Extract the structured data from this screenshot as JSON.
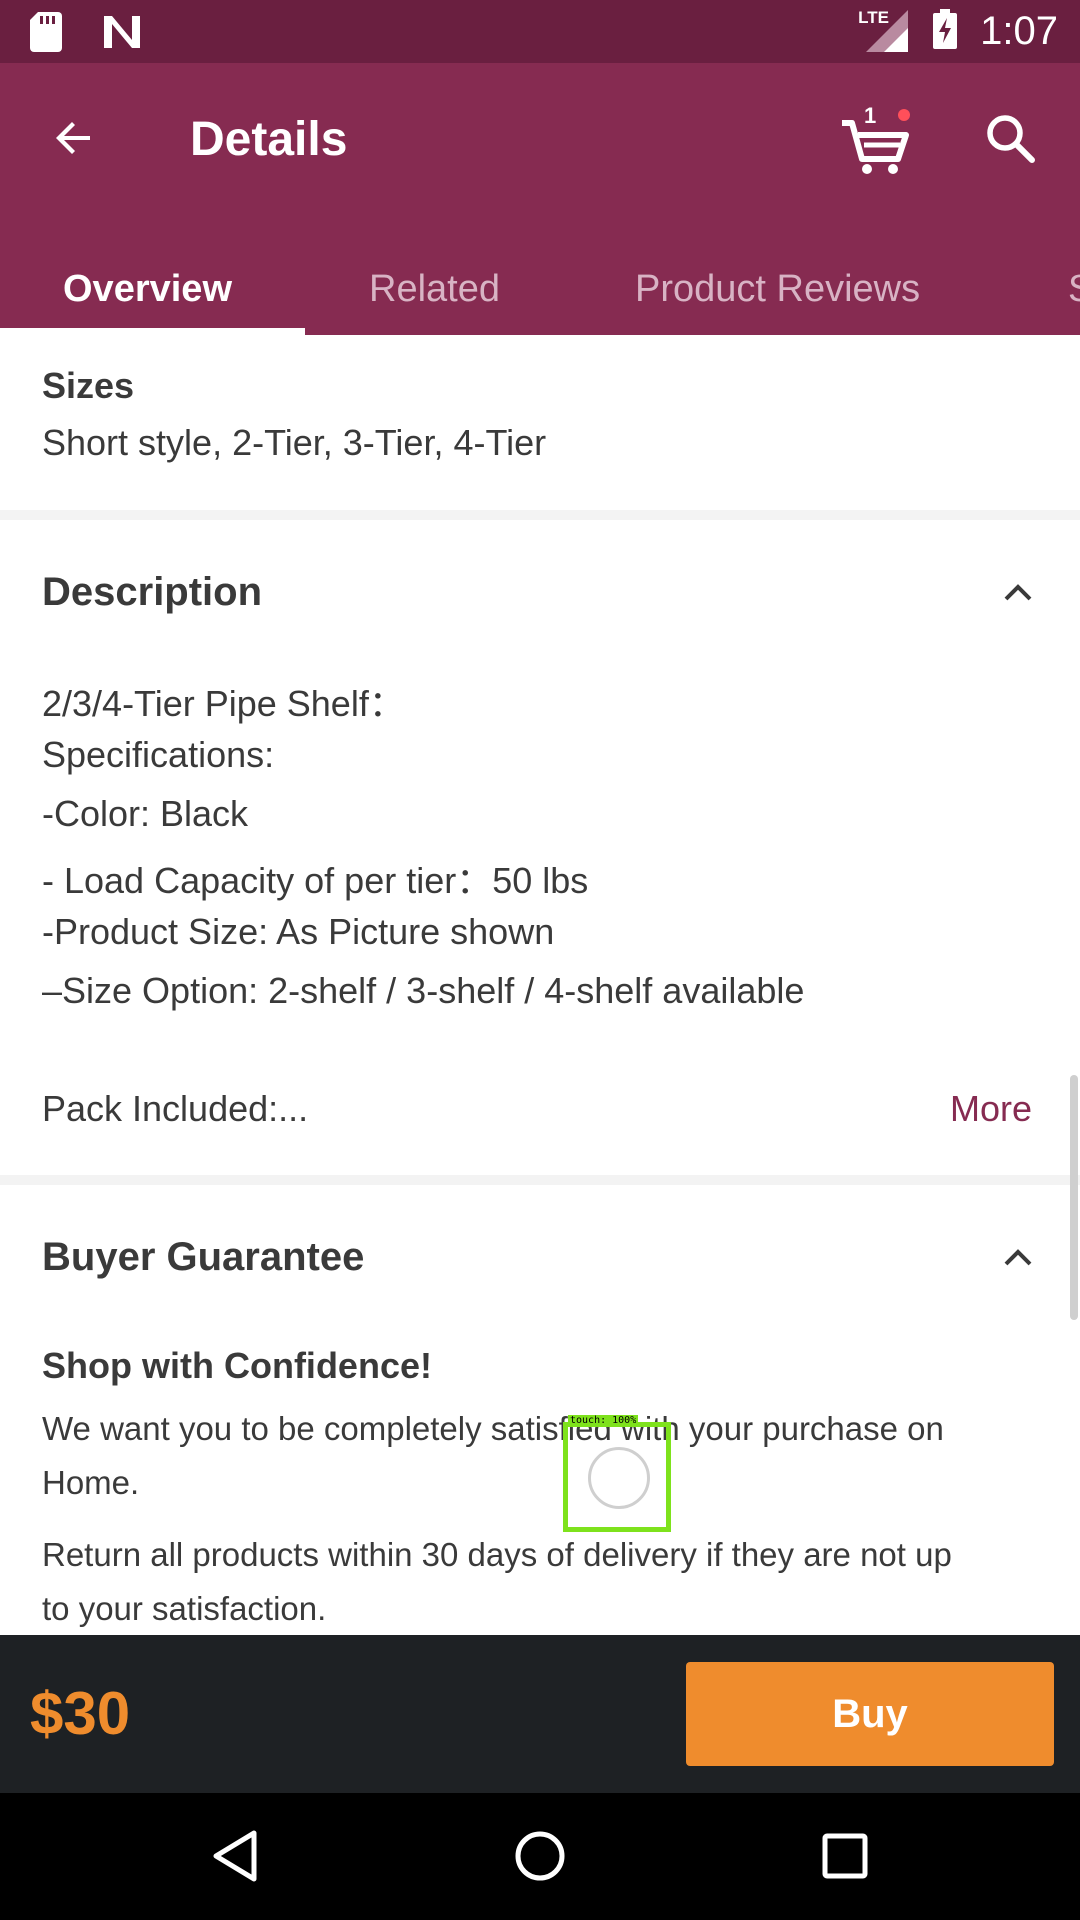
{
  "status_bar": {
    "network": "LTE",
    "time": "1:07",
    "icons": [
      "sd-card-icon",
      "n-notification-icon",
      "signal-icon",
      "battery-charging-icon"
    ]
  },
  "app_bar": {
    "title": "Details",
    "cart_count": "1",
    "back_icon": "arrow-left-icon",
    "cart_icon": "cart-icon",
    "search_icon": "search-icon"
  },
  "tabs": [
    {
      "label": "Overview",
      "active": true
    },
    {
      "label": "Related",
      "active": false
    },
    {
      "label": "Product Reviews",
      "active": false
    },
    {
      "label": "S",
      "active": false
    }
  ],
  "sizes": {
    "label": "Sizes",
    "value": "Short style, 2-Tier, 3-Tier, 4-Tier"
  },
  "description": {
    "title": "Description",
    "lines": [
      "2/3/4-Tier Pipe Shelf：",
      "Specifications:",
      "-Color: Black",
      "- Load Capacity of per tier：50 lbs",
      "-Product Size: As Picture shown",
      "–Size Option: 2-shelf / 3-shelf / 4-shelf  available"
    ],
    "pack_included": "Pack Included:...",
    "more_label": "More"
  },
  "buyer_guarantee": {
    "title": "Buyer Guarantee",
    "heading": "Shop with Confidence!",
    "para1_line1": "We want you to be completely satisfied with your purchase on",
    "para1_line2": "Home.",
    "para2_line1": "Return all products within 30 days of delivery if they are not up",
    "para2_line2": "to your satisfaction."
  },
  "bottom_bar": {
    "price": "$30",
    "buy_label": "Buy"
  },
  "touch_overlay": {
    "label": "touch: 100%"
  },
  "colors": {
    "status_bar": "#6a1f40",
    "app_bar": "#862b51",
    "accent_orange": "#ef8c2d",
    "bottom_bar": "#1e2124"
  }
}
